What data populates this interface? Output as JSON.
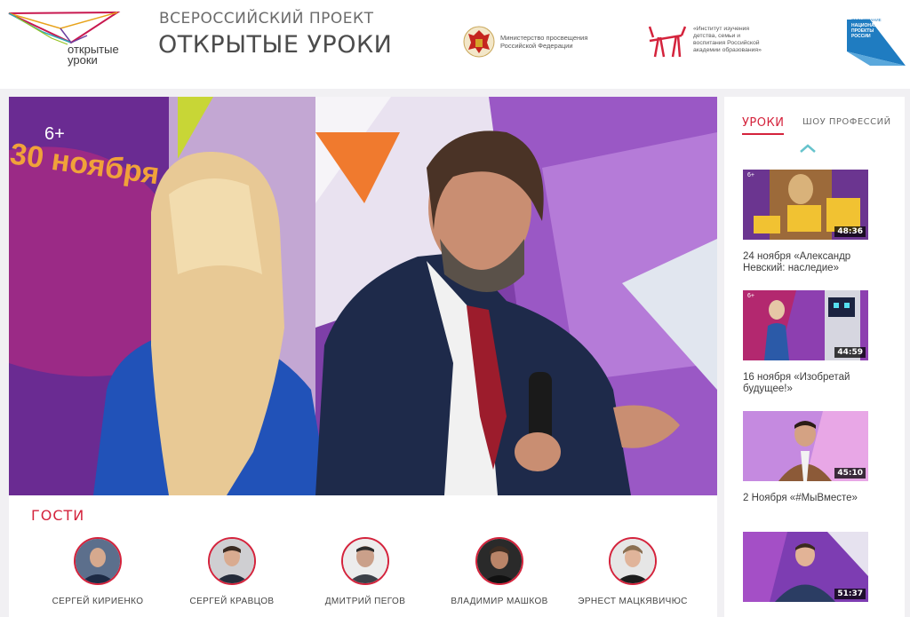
{
  "header": {
    "logo_text": "открытые\nуроки",
    "project_subtitle": "ВСЕРОССИЙСКИЙ ПРОЕКТ",
    "project_title": "ОТКРЫТЫЕ УРОКИ",
    "partners": [
      {
        "text": "Министерство просвещения\nРоссийской Федерации",
        "icon": "coat-of-arms-icon"
      },
      {
        "text": "«Институт изучения\nдетства, семьи и\nвоспитания Российской\nакадемии образования»",
        "icon": "institute-logo-icon"
      },
      {
        "top": "ОБРАЗОВАНИЕ",
        "text": "НАЦИОНАЛЬНЫЕ\nПРОЕКТЫ\nРОССИИ",
        "icon": "national-projects-logo"
      }
    ]
  },
  "video": {
    "age_badge": "6+",
    "date_overlay": "30 ноября"
  },
  "guests": {
    "title": "ГОСТИ",
    "items": [
      {
        "name": "СЕРГЕЙ КИРИЕНКО"
      },
      {
        "name": "СЕРГЕЙ КРАВЦОВ"
      },
      {
        "name": "ДМИТРИЙ ПЕГОВ"
      },
      {
        "name": "ВЛАДИМИР МАШКОВ"
      },
      {
        "name": "ЭРНЕСТ МАЦКЯВИЧЮС"
      }
    ]
  },
  "sidebar": {
    "tabs": [
      {
        "label": "УРОКИ",
        "active": true
      },
      {
        "label": "ШОУ ПРОФЕССИЙ",
        "active": false
      }
    ],
    "lessons": [
      {
        "caption": "24 ноября «Александр Невский: наследие»",
        "duration": "48:36",
        "age": "6+"
      },
      {
        "caption": "16 ноября «Изобретай будущее!»",
        "duration": "44:59",
        "age": "6+"
      },
      {
        "caption": "2 Ноября «#МыВместе»",
        "duration": "45:10",
        "age": ""
      },
      {
        "caption": "",
        "duration": "51:37",
        "age": ""
      }
    ]
  },
  "colors": {
    "accent": "#d4233c",
    "stage_purple": "#8a4bb0",
    "stage_orange": "#f07a2e"
  }
}
